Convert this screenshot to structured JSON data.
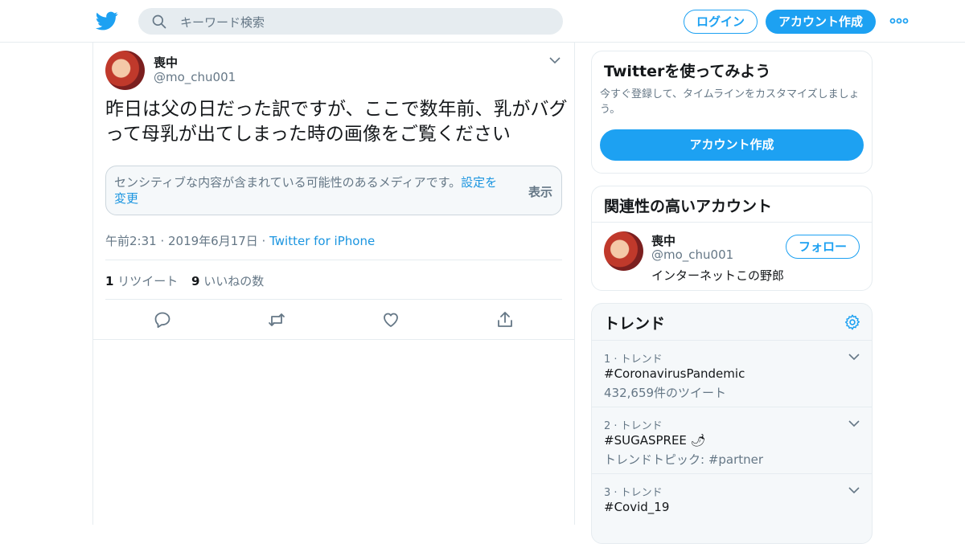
{
  "header": {
    "search_placeholder": "キーワード検索",
    "login_label": "ログイン",
    "signup_label": "アカウント作成"
  },
  "tweet": {
    "name": "喪中",
    "handle": "@mo_chu001",
    "text": "昨日は父の日だった訳ですが、ここで数年前、乳がバグって母乳が出てしまった時の画像をご覧ください",
    "sensitive_msg": "センシティブな内容が含まれている可能性のあるメディアです。",
    "sensitive_link": "設定を変更",
    "show_label": "表示",
    "timestamp": "午前2:31 · 2019年6月17日 · ",
    "source": "Twitter for iPhone",
    "retweet_count": "1",
    "retweet_label": " リツイート",
    "like_count": "9",
    "like_label": " いいねの数"
  },
  "sidebar": {
    "signup_card": {
      "title": "Twitterを使ってみよう",
      "desc": "今すぐ登録して、タイムラインをカスタマイズしましょう。",
      "cta": "アカウント作成"
    },
    "related": {
      "title": "関連性の高いアカウント",
      "name": "喪中",
      "handle": "@mo_chu001",
      "bio": "インターネットこの野郎",
      "follow_label": "フォロー"
    },
    "trends": {
      "title": "トレンド",
      "items": [
        {
          "rank": "1 · トレンド",
          "tag": "#CoronavirusPandemic",
          "sub": "432,659件のツイート"
        },
        {
          "rank": "2 · トレンド",
          "tag": "#SUGASPREE 🌶",
          "sub": "トレンドトピック: #partner"
        },
        {
          "rank": "3 · トレンド",
          "tag": "#Covid_19",
          "sub": ""
        }
      ]
    }
  },
  "colors": {
    "accent": "#1da1f2",
    "link": "#1b95e0",
    "muted": "#657786",
    "border": "#e6ecf0"
  }
}
